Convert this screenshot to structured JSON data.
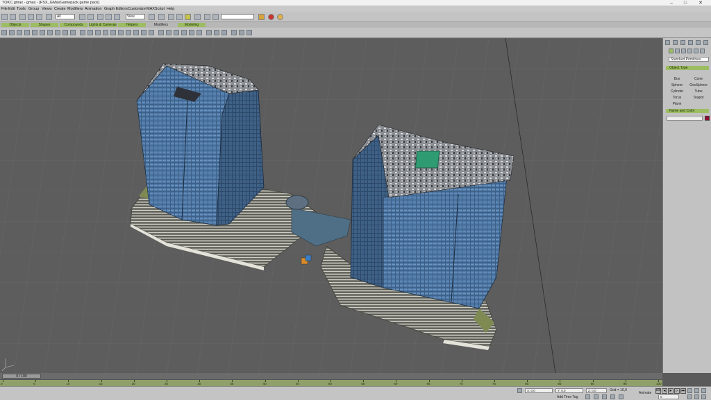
{
  "window": {
    "title": "TOKC.gmax - gmax - [FSX_GMaxGamepack.game pack]",
    "minimize_icon": "minimize-icon",
    "maximize_icon": "maximize-icon",
    "close_glyph": "✕"
  },
  "menu": {
    "items": [
      "File",
      "Edit",
      "Tools",
      "Group",
      "Views",
      "Create",
      "Modifiers",
      "Animation",
      "Graph Editors",
      "Customize",
      "MAXScript",
      "Help"
    ]
  },
  "toolbar": {
    "selection_filter": "All",
    "reference_coord": "View",
    "named_selection": ""
  },
  "command_tabs": [
    {
      "label": "Objects",
      "active": true
    },
    {
      "label": "Shapes",
      "active": true
    },
    {
      "label": "Compounds",
      "active": true
    },
    {
      "label": "Lights & Cameras",
      "active": true
    },
    {
      "label": "Helpers",
      "active": true
    },
    {
      "label": "Modifiers",
      "active": false
    },
    {
      "label": "Modeling",
      "active": true
    }
  ],
  "command_panel": {
    "category_dropdown": "Standard Primitives",
    "object_type_title": "Object Type",
    "autogrid": "",
    "buttons": [
      "Box",
      "Cone",
      "Sphere",
      "GeoSphere",
      "Cylinder",
      "Tube",
      "Torus",
      "Teapot",
      "Plane"
    ],
    "name_color_title": "Name and Color",
    "object_name": "",
    "object_color": "#8e0a2e"
  },
  "time": {
    "slider_label": "0 / 100",
    "frame_ticks": [
      "0",
      "5",
      "10",
      "15",
      "20",
      "25",
      "30",
      "35",
      "40",
      "45",
      "50",
      "55",
      "60",
      "65",
      "70",
      "75",
      "80",
      "85",
      "90",
      "95",
      "100"
    ]
  },
  "status": {
    "grid": "Grid = 10,0",
    "add_time_tag": "Add Time Tag",
    "animate": "Animate",
    "frame": "0",
    "x_field": "X: 0,0",
    "y_field": "Y: 0,0",
    "z_field": "Z: 0,0"
  },
  "colors": {
    "accent_green": "#9dbd63",
    "viewport_bg": "#5d5d5d",
    "ui_gray": "#c4c4c4"
  }
}
